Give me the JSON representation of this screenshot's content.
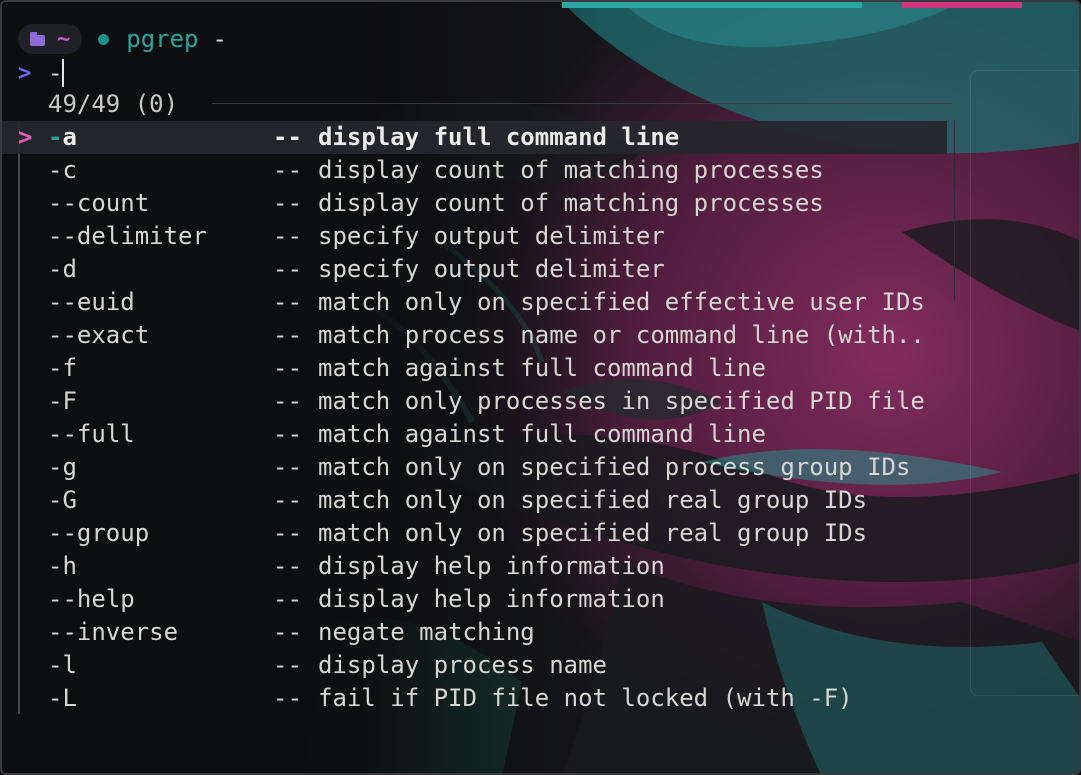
{
  "prompt": {
    "folder_icon": "folder-icon",
    "directory": "~",
    "command": "pgrep",
    "command_arg": "-"
  },
  "input": {
    "prompt_symbol": ">",
    "query": "-"
  },
  "match_count": "49/49 (0)",
  "completions": [
    {
      "option": "-a",
      "description": "display full command line",
      "selected": true
    },
    {
      "option": "-c",
      "description": "display count of matching processes"
    },
    {
      "option": "--count",
      "description": "display count of matching processes"
    },
    {
      "option": "--delimiter",
      "description": "specify output delimiter"
    },
    {
      "option": "-d",
      "description": "specify output delimiter"
    },
    {
      "option": "--euid",
      "description": "match only on specified effective user IDs"
    },
    {
      "option": "--exact",
      "description": "match process name or command line (with.."
    },
    {
      "option": "-f",
      "description": "match against full command line"
    },
    {
      "option": "-F",
      "description": "match only processes in specified PID file"
    },
    {
      "option": "--full",
      "description": "match against full command line"
    },
    {
      "option": "-g",
      "description": "match only on specified process group IDs"
    },
    {
      "option": "-G",
      "description": "match only on specified real group IDs"
    },
    {
      "option": "--group",
      "description": "match only on specified real group IDs"
    },
    {
      "option": "-h",
      "description": "display help information"
    },
    {
      "option": "--help",
      "description": "display help information"
    },
    {
      "option": "--inverse",
      "description": "negate matching"
    },
    {
      "option": "-l",
      "description": "display process name"
    },
    {
      "option": "-L",
      "description": "fail if PID file not locked (with -F)"
    }
  ],
  "separator": "--",
  "selection_pointer": ">",
  "colors": {
    "accent_teal": "#2ba4a0",
    "accent_magenta": "#e05bb6",
    "accent_purple": "#7266f0",
    "text": "#d6d6d2"
  }
}
